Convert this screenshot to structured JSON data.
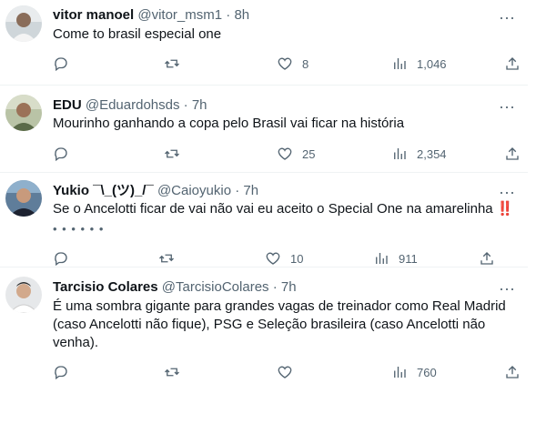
{
  "tweets": [
    {
      "name": "vitor manoel",
      "handle": "@vitor_msm1",
      "dot": "·",
      "time": "8h",
      "text": "Come to brasil especial one",
      "extra": "",
      "replies": "",
      "retweets": "",
      "likes": "8",
      "views": "1,046"
    },
    {
      "name": "EDU",
      "handle": "@Eduardohsds",
      "dot": "·",
      "time": "7h",
      "text": "Mourinho ganhando a copa pelo Brasil vai ficar na história",
      "extra": "",
      "replies": "",
      "retweets": "",
      "likes": "25",
      "views": "2,354"
    },
    {
      "name": "Yukio ¯\\_(ツ)_/¯",
      "handle": "@Caioyukio",
      "dot": "·",
      "time": "7h",
      "text": "Se o Ancelotti ficar de vai não vai eu aceito o Special One na amarelinha",
      "emoji": "‼️",
      "extra": "• • • • • •",
      "replies": "",
      "retweets": "",
      "likes": "10",
      "views": "911"
    },
    {
      "name": "Tarcisio Colares",
      "handle": "@TarcisioColares",
      "dot": "·",
      "time": "7h",
      "text": "É uma sombra gigante para grandes vagas de treinador como Real Madrid (caso Ancelotti não fique), PSG e Seleção brasileira (caso Ancelotti não venha).",
      "extra": "",
      "replies": "",
      "retweets": "",
      "likes": "",
      "views": "760"
    }
  ],
  "more_label": "···",
  "icons": {
    "reply": "reply-icon",
    "retweet": "retweet-icon",
    "like": "heart-icon",
    "views": "views-icon",
    "share": "share-icon"
  },
  "colors": {
    "text": "#0f1419",
    "muted": "#536471",
    "border": "#eff3f4"
  }
}
